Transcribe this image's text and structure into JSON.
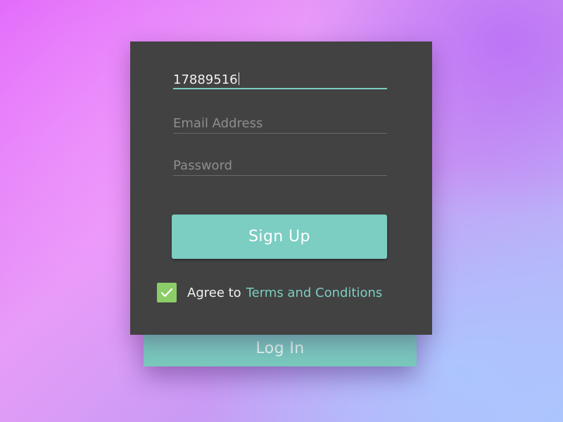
{
  "form": {
    "username_value": "17889516",
    "email_placeholder": "Email Address",
    "password_placeholder": "Password",
    "signup_label": "Sign Up",
    "agree_checked": true,
    "agree_text": "Agree to",
    "terms_link": "Terms and Conditions"
  },
  "login": {
    "label": "Log In"
  },
  "colors": {
    "accent": "#7ccdc2",
    "card": "#424242",
    "checkbox": "#8ccd6a"
  },
  "icons": {
    "checkbox": "check-icon"
  }
}
